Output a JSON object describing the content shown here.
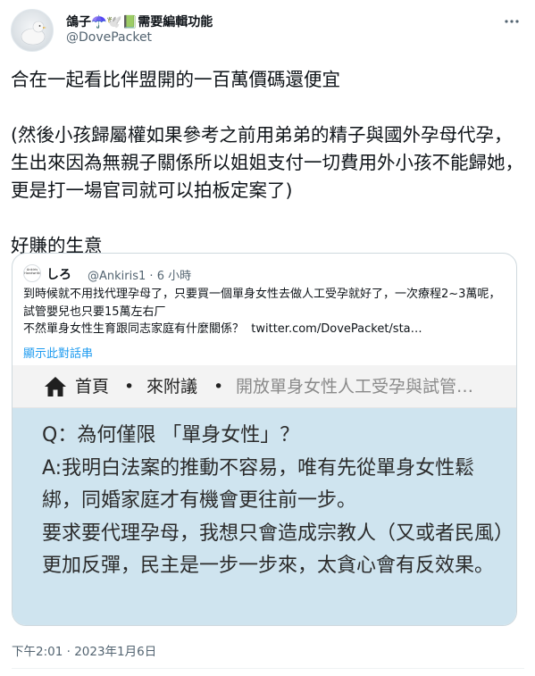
{
  "author": {
    "display_name": "鴿子",
    "name_emojis": "☂️🕊️📗",
    "name_suffix": "需要編輯功能",
    "handle": "@DovePacket"
  },
  "more_icon": "more-horizontal-icon",
  "tweet": {
    "text": "合在一起看比伴盟開的一百萬價碼還便宜\n\n(然後小孩歸屬權如果參考之前用弟弟的精子與國外孕母代孕，生出來因為無親子關係所以姐姐支付一切費用外小孩不能歸她，更是打一場官司就可以拍板定案了)\n\n好賺的生意"
  },
  "quote": {
    "avatar_text": "Ankiris Handwriting",
    "author_name": "しろ",
    "author_handle": "@Ankiris1",
    "separator": "·",
    "time_ago": "6 小時",
    "text": "到時候就不用找代理孕母了，只要買一個單身女性去做人工受孕就好了，一次療程2~3萬呢，試管嬰兒也只要15萬左右厂\n不然單身女性生育跟同志家庭有什麼關係？  twitter.com/DovePacket/sta…",
    "show_thread": "顯示此對話串",
    "image": {
      "breadcrumb_home": "首頁",
      "breadcrumb_sep": "•",
      "breadcrumb_category": "來附議",
      "breadcrumb_current": "開放單身女性人工受孕與試管…",
      "body": "Q：為何僅限 「單身女性」？\nA:我明白法案的推動不容易，唯有先從單身女性鬆綁，同婚家庭才有機會更往前一步。\n要求要代理孕母，我想只會造成宗教人（又或者民風）更加反彈，民主是一步一步來，太貪心會有反效果。"
    }
  },
  "timestamp": "下午2:01 · 2023年1月6日",
  "colors": {
    "link": "#1d9bf0",
    "muted": "#536471",
    "image_bg": "#cfe4ef",
    "border": "#cfd9de"
  }
}
